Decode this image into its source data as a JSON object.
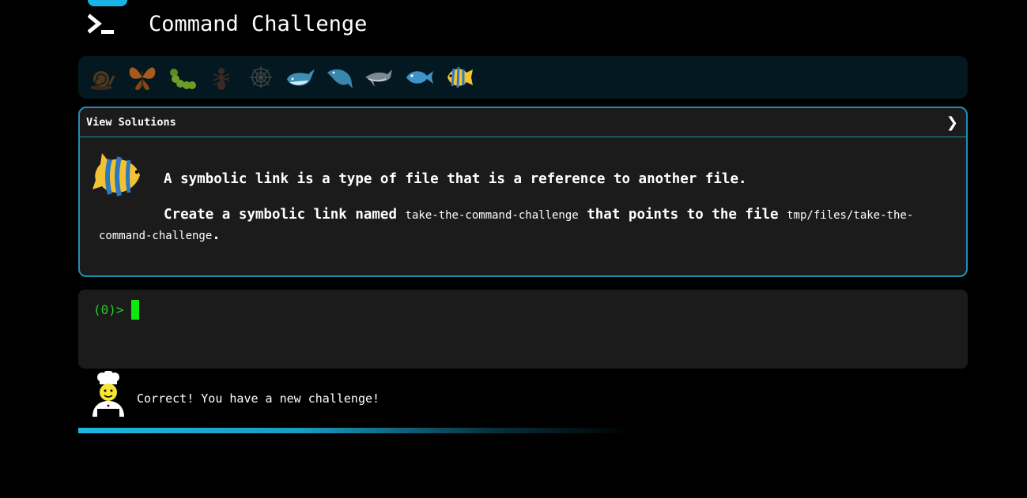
{
  "app": {
    "title": "Command Challenge",
    "logo_icon": "terminal-prompt-icon",
    "accent": "#19b3e6"
  },
  "levels": [
    {
      "name": "snail",
      "icon": "snail-icon"
    },
    {
      "name": "butterfly",
      "icon": "butterfly-icon"
    },
    {
      "name": "caterpillar",
      "icon": "caterpillar-icon"
    },
    {
      "name": "ant",
      "icon": "ant-icon"
    },
    {
      "name": "spider-web",
      "icon": "spider-web-icon"
    },
    {
      "name": "whale",
      "icon": "whale-icon"
    },
    {
      "name": "whale-2",
      "icon": "whale-2-icon"
    },
    {
      "name": "dolphin",
      "icon": "dolphin-icon"
    },
    {
      "name": "fish",
      "icon": "fish-icon"
    },
    {
      "name": "tropical-fish",
      "icon": "tropical-fish-icon",
      "current": true
    }
  ],
  "challenge": {
    "view_solutions_label": "View Solutions",
    "toggle_glyph": "❯",
    "intro": "A symbolic link is a type of file that is a reference to another file.",
    "task_prefix": "Create a symbolic link named ",
    "task_link_name": "take-the-command-challenge",
    "task_middle": " that points to the file ",
    "task_target": "tmp/files/take-the-command-challenge",
    "task_suffix": "."
  },
  "terminal": {
    "prompt": "(0)>"
  },
  "feedback": {
    "message": "Correct! You have a new challenge!"
  },
  "colors": {
    "panel_border": "#1f8fb0",
    "prompt": "#1fd31f",
    "cursor": "#11e80f",
    "level_bar_bg": "#031820"
  }
}
